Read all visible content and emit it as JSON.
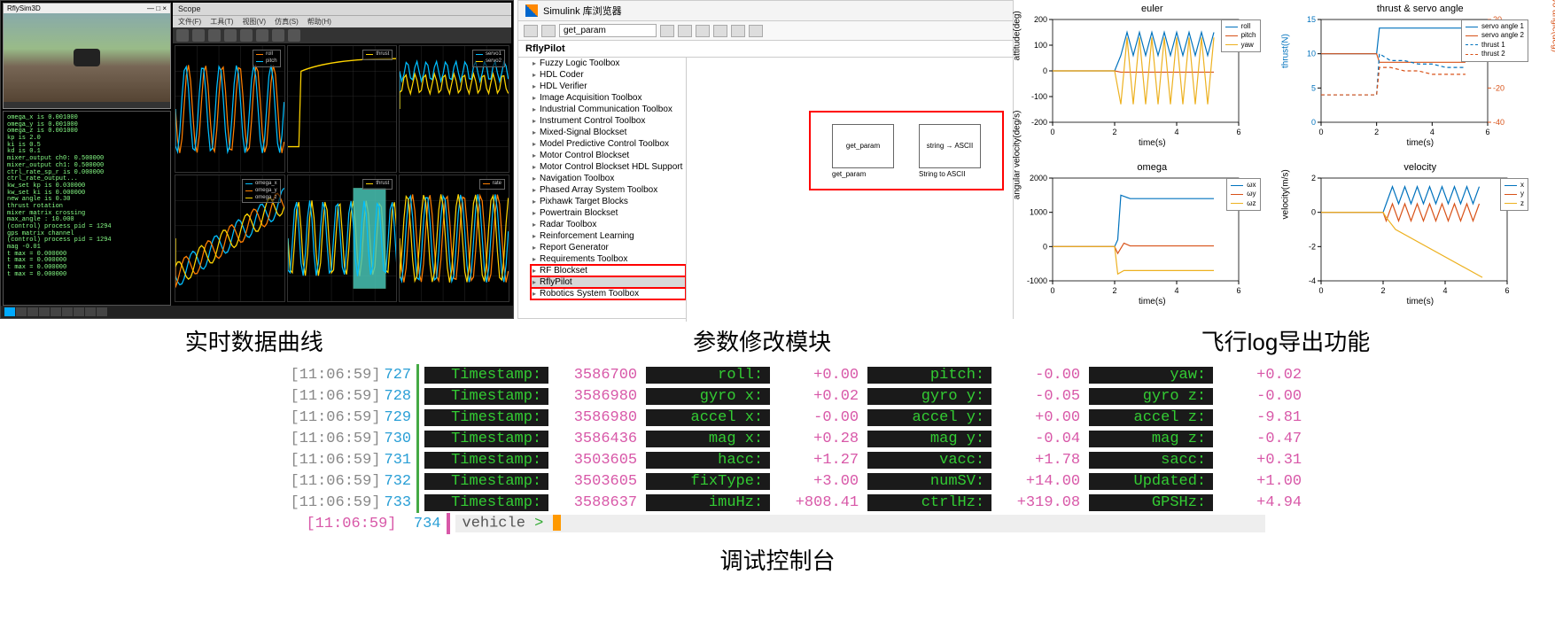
{
  "panel1": {
    "rfly_title": "RflySim3D",
    "winmin": "—",
    "winmax": "□",
    "winclose": "×",
    "terminal_lines": [
      "omega_x is 0.001000",
      "omega_y is 0.001000",
      "omega_z is 0.001000",
      "kp is 2.0",
      "ki is 0.5",
      "kd is 0.1",
      "mixer_output ch0: 0.500000",
      "mixer_output ch1: 0.500000",
      "ctrl_rate_sp_r is 0.000000",
      "ctrl_rate_output...",
      "kw_set kp is 0.030000",
      "kw_set ki is 0.000000",
      "new angle is 0.30",
      "thrust rotation",
      "mixer matrix crossing",
      "max_angle  : 10.000",
      "(control) process pid = 1294",
      "gps matrix channel",
      "(control) process pid = 1294",
      "mag -0.01",
      "t max = 0.000000",
      "t max = 0.000000",
      "t max = 0.000000",
      "t max = 0.000000"
    ],
    "scope_title": "Scope",
    "scope_menu": [
      "文件(F)",
      "工具(T)",
      "视图(V)",
      "仿真(S)",
      "帮助(H)"
    ],
    "scope_cells": {
      "c1": {
        "legend": [
          "roll",
          "pitch"
        ],
        "colors": [
          "#ff7f00",
          "#00bfff"
        ]
      },
      "c2": {
        "legend": [
          "thrust"
        ],
        "colors": [
          "#ffd400"
        ]
      },
      "c3": {
        "legend": [
          "servo1",
          "servo2"
        ],
        "colors": [
          "#00bfff",
          "#ffd400"
        ]
      },
      "c4": {
        "legend": [
          "omega_x",
          "omega_y",
          "omega_z"
        ],
        "colors": [
          "#00bfff",
          "#ff7f00",
          "#ffd400"
        ]
      },
      "c5": {
        "legend": [
          "thrust"
        ],
        "colors": [
          "#ffd400",
          "#00bfff"
        ]
      },
      "c6": {
        "legend": [
          "rate"
        ],
        "colors": [
          "#ff7f00",
          "#00bfff",
          "#ffd400"
        ]
      }
    }
  },
  "panel2": {
    "title": "Simulink 库浏览器",
    "search_value": "get_param",
    "header": "RflyPilot",
    "tree": [
      "Fuzzy Logic Toolbox",
      "HDL Coder",
      "HDL Verifier",
      "Image Acquisition Toolbox",
      "Industrial Communication Toolbox",
      "Instrument Control Toolbox",
      "Mixed-Signal Blockset",
      "Model Predictive Control Toolbox",
      "Motor Control Blockset",
      "Motor Control Blockset HDL Support",
      "Navigation Toolbox",
      "Phased Array System Toolbox",
      "Pixhawk Target Blocks",
      "Powertrain Blockset",
      "Radar Toolbox",
      "Reinforcement Learning",
      "Report Generator",
      "Requirements Toolbox",
      "RF Blockset",
      "RflyPilot",
      "Robotics System Toolbox"
    ],
    "tree_sel_idx": 19,
    "tree_red_start": 18,
    "tree_red_end": 20,
    "block1_txt": "get_param",
    "block1_name": "get_param",
    "block2_txt": "string → ASCII",
    "block2_name": "String to ASCII"
  },
  "panel3": {
    "labels": {
      "time": "time(s)"
    },
    "p1": {
      "title": "euler",
      "ylabel": "attitude(deg)",
      "legend": [
        "roll",
        "pitch",
        "yaw"
      ],
      "colors": [
        "#0072bd",
        "#d85218",
        "#edb120"
      ],
      "xt": [
        0,
        2,
        4,
        6
      ],
      "yt": [
        -200,
        -100,
        0,
        100,
        200
      ]
    },
    "p2": {
      "title": "thrust & servo angle",
      "ylabel": "thrust(N)",
      "ylabel2": "servo angle(deg)",
      "legend": [
        "servo angle 1",
        "servo angle 2",
        "thrust 1",
        "thrust 2"
      ],
      "colors": [
        "#0072bd",
        "#d85218",
        "#0072bd",
        "#d85218"
      ],
      "dash": [
        false,
        false,
        true,
        true
      ],
      "xt": [
        0,
        2,
        4,
        6
      ],
      "yt": [
        0,
        5,
        10,
        15
      ],
      "yt2": [
        -40,
        -20,
        0,
        20
      ]
    },
    "p3": {
      "title": "omega",
      "ylabel": "angular velocity(deg/s)",
      "legend": [
        "ωx",
        "ωy",
        "ωz"
      ],
      "colors": [
        "#0072bd",
        "#d85218",
        "#edb120"
      ],
      "xt": [
        0,
        2,
        4,
        6
      ],
      "yt": [
        -1000,
        0,
        1000,
        2000
      ]
    },
    "p4": {
      "title": "velocity",
      "ylabel": "velocity(m/s)",
      "legend": [
        "x",
        "y",
        "z"
      ],
      "colors": [
        "#0072bd",
        "#d85218",
        "#edb120"
      ],
      "xt": [
        0,
        2,
        4,
        6
      ],
      "yt": [
        -4,
        -2,
        0,
        2
      ]
    }
  },
  "labels": {
    "l1": "实时数据曲线",
    "l2": "参数修改模块",
    "l3": "飞行log导出功能",
    "bottom": "调试控制台"
  },
  "console": {
    "prompt_text": "vehicle",
    "prompt_caret": ">",
    "rows": [
      {
        "ts": "[11:06:59]",
        "ln": "727",
        "kv": [
          [
            "Timestamp:",
            "3586700"
          ],
          [
            "roll:",
            "+0.00"
          ],
          [
            "pitch:",
            "-0.00"
          ],
          [
            "yaw:",
            "+0.02"
          ]
        ]
      },
      {
        "ts": "[11:06:59]",
        "ln": "728",
        "kv": [
          [
            "Timestamp:",
            "3586980"
          ],
          [
            "gyro x:",
            "+0.02"
          ],
          [
            "gyro y:",
            "-0.05"
          ],
          [
            "gyro z:",
            "-0.00"
          ]
        ]
      },
      {
        "ts": "[11:06:59]",
        "ln": "729",
        "kv": [
          [
            "Timestamp:",
            "3586980"
          ],
          [
            "accel x:",
            "-0.00"
          ],
          [
            "accel y:",
            "+0.00"
          ],
          [
            "accel z:",
            "-9.81"
          ]
        ]
      },
      {
        "ts": "[11:06:59]",
        "ln": "730",
        "kv": [
          [
            "Timestamp:",
            "3586436"
          ],
          [
            "mag x:",
            "+0.28"
          ],
          [
            "mag y:",
            "-0.04"
          ],
          [
            "mag z:",
            "-0.47"
          ]
        ]
      },
      {
        "ts": "[11:06:59]",
        "ln": "731",
        "kv": [
          [
            "Timestamp:",
            "3503605"
          ],
          [
            "hacc:",
            "+1.27"
          ],
          [
            "vacc:",
            "+1.78"
          ],
          [
            "sacc:",
            "+0.31"
          ]
        ]
      },
      {
        "ts": "[11:06:59]",
        "ln": "732",
        "kv": [
          [
            "Timestamp:",
            "3503605"
          ],
          [
            "fixType:",
            "+3.00"
          ],
          [
            "numSV:",
            "+14.00"
          ],
          [
            "Updated:",
            "+1.00"
          ]
        ]
      },
      {
        "ts": "[11:06:59]",
        "ln": "733",
        "kv": [
          [
            "Timestamp:",
            "3588637"
          ],
          [
            "imuHz:",
            "+808.41"
          ],
          [
            "ctrlHz:",
            "+319.08"
          ],
          [
            "GPSHz:",
            "+4.94"
          ]
        ]
      }
    ],
    "prompt": {
      "ts": "[11:06:59]",
      "ln": "734"
    }
  },
  "chart_data": [
    {
      "type": "line",
      "title": "euler",
      "xlabel": "time(s)",
      "ylabel": "attitude(deg)",
      "xlim": [
        0,
        6
      ],
      "ylim": [
        -200,
        200
      ],
      "series": [
        {
          "name": "roll",
          "x": [
            0,
            2,
            2.2,
            2.4,
            2.6,
            2.8,
            3,
            3.2,
            3.4,
            3.6,
            3.8,
            4,
            4.2,
            4.4,
            4.6,
            4.8,
            5,
            5.2
          ],
          "y": [
            0,
            0,
            60,
            150,
            60,
            150,
            60,
            150,
            60,
            150,
            60,
            150,
            60,
            150,
            60,
            150,
            60,
            150
          ]
        },
        {
          "name": "pitch",
          "x": [
            0,
            2,
            2.2,
            5.2
          ],
          "y": [
            0,
            0,
            -5,
            -5
          ]
        },
        {
          "name": "yaw",
          "x": [
            0,
            2,
            2.2,
            2.4,
            2.6,
            2.8,
            3,
            3.2,
            3.4,
            3.6,
            3.8,
            4,
            4.2,
            4.4,
            4.6,
            4.8,
            5,
            5.2
          ],
          "y": [
            0,
            0,
            -130,
            130,
            -130,
            130,
            -130,
            130,
            -130,
            130,
            -130,
            130,
            -130,
            130,
            -130,
            130,
            -130,
            130
          ]
        }
      ]
    },
    {
      "type": "line",
      "title": "thrust & servo angle",
      "xlabel": "time(s)",
      "ylabel": "thrust(N)",
      "ylabel2": "servo angle(deg)",
      "xlim": [
        0,
        6
      ],
      "ylim": [
        0,
        15
      ],
      "ylim2": [
        -40,
        20
      ],
      "series": [
        {
          "name": "servo angle 1",
          "axis": "y2",
          "x": [
            0,
            2,
            2.1,
            5.2
          ],
          "y": [
            0,
            0,
            15,
            15
          ]
        },
        {
          "name": "servo angle 2",
          "axis": "y2",
          "x": [
            0,
            2,
            2.1,
            5.2
          ],
          "y": [
            0,
            0,
            -5,
            -5
          ]
        },
        {
          "name": "thrust 1",
          "x": [
            0,
            2,
            2.1,
            2.5,
            3,
            3.5,
            4,
            4.5,
            5,
            5.2
          ],
          "y": [
            4,
            4,
            10,
            9,
            9,
            8.5,
            8.5,
            8,
            8,
            8
          ]
        },
        {
          "name": "thrust 2",
          "x": [
            0,
            2,
            2.1,
            2.5,
            3,
            3.5,
            4,
            4.5,
            5,
            5.2
          ],
          "y": [
            4,
            4,
            8,
            8,
            7.5,
            7.5,
            7,
            7,
            7,
            7
          ]
        }
      ]
    },
    {
      "type": "line",
      "title": "omega",
      "xlabel": "time(s)",
      "ylabel": "angular velocity(deg/s)",
      "xlim": [
        0,
        6
      ],
      "ylim": [
        -1000,
        2000
      ],
      "series": [
        {
          "name": "ωx",
          "x": [
            0,
            2,
            2.1,
            2.2,
            2.5,
            5.2
          ],
          "y": [
            0,
            0,
            200,
            1500,
            1400,
            1400
          ]
        },
        {
          "name": "ωy",
          "x": [
            0,
            2,
            2.1,
            2.3,
            2.5,
            5.2
          ],
          "y": [
            0,
            0,
            -200,
            100,
            20,
            20
          ]
        },
        {
          "name": "ωz",
          "x": [
            0,
            2,
            2.1,
            2.3,
            2.5,
            5.2
          ],
          "y": [
            0,
            0,
            -800,
            -700,
            -700,
            -700
          ]
        }
      ]
    },
    {
      "type": "line",
      "title": "velocity",
      "xlabel": "time(s)",
      "ylabel": "velocity(m/s)",
      "xlim": [
        0,
        6
      ],
      "ylim": [
        -4,
        2
      ],
      "series": [
        {
          "name": "x",
          "x": [
            0,
            2,
            2.1,
            2.3,
            2.5,
            2.7,
            2.9,
            3.1,
            3.3,
            3.5,
            3.7,
            3.9,
            4.1,
            4.3,
            4.5,
            4.7,
            4.9,
            5.1
          ],
          "y": [
            0,
            0,
            0.5,
            1.5,
            0.5,
            1.5,
            0.5,
            1.5,
            0.5,
            1.5,
            0.5,
            1.5,
            0.5,
            1.5,
            0.5,
            1.5,
            0.5,
            1.5
          ]
        },
        {
          "name": "y",
          "x": [
            0,
            2,
            2.1,
            2.3,
            2.5,
            2.7,
            2.9,
            3.1,
            3.3,
            3.5,
            3.7,
            3.9,
            4.1,
            4.3,
            4.5,
            4.7,
            4.9,
            5.1
          ],
          "y": [
            0,
            0,
            -0.5,
            0.5,
            -0.5,
            0.5,
            -0.5,
            0.5,
            -0.5,
            0.5,
            -0.5,
            0.5,
            -0.5,
            0.5,
            -0.5,
            0.5,
            -0.5,
            0.5
          ]
        },
        {
          "name": "z",
          "x": [
            0,
            2,
            2.1,
            2.4,
            5.2
          ],
          "y": [
            0,
            0,
            -0.3,
            -1.0,
            -3.8
          ]
        }
      ]
    }
  ]
}
